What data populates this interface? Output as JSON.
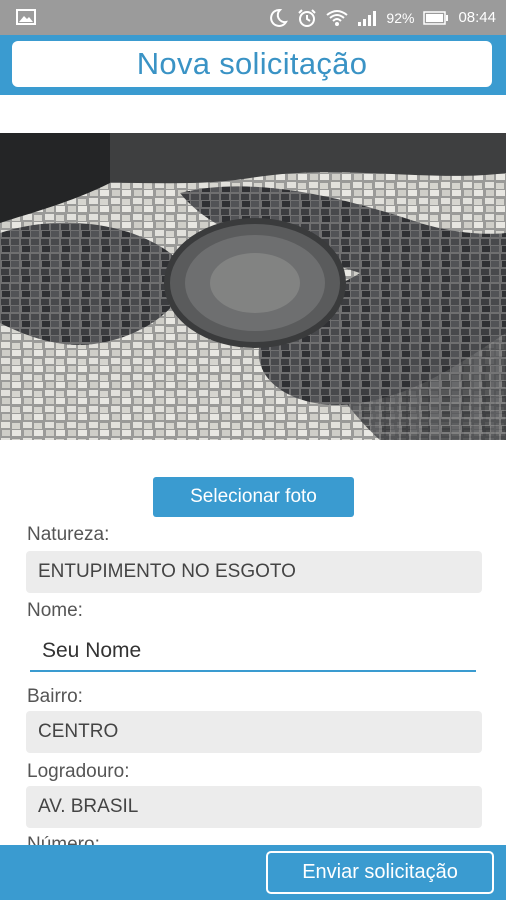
{
  "status_bar": {
    "battery_percent": "92%",
    "time": "08:44"
  },
  "header": {
    "title": "Nova solicitação"
  },
  "photo": {
    "select_button": "Selecionar foto"
  },
  "form": {
    "natureza": {
      "label": "Natureza:",
      "value": "ENTUPIMENTO NO ESGOTO"
    },
    "nome": {
      "label": "Nome:",
      "placeholder": "Seu Nome"
    },
    "bairro": {
      "label": "Bairro:",
      "value": "CENTRO"
    },
    "logradouro": {
      "label": "Logradouro:",
      "value": "AV. BRASIL"
    },
    "numero": {
      "label": "Número:"
    }
  },
  "footer": {
    "send_button": "Enviar solicitação"
  },
  "colors": {
    "accent": "#3a9bd0",
    "status_bar": "#9b9b9b",
    "field_bg": "#ececec"
  }
}
